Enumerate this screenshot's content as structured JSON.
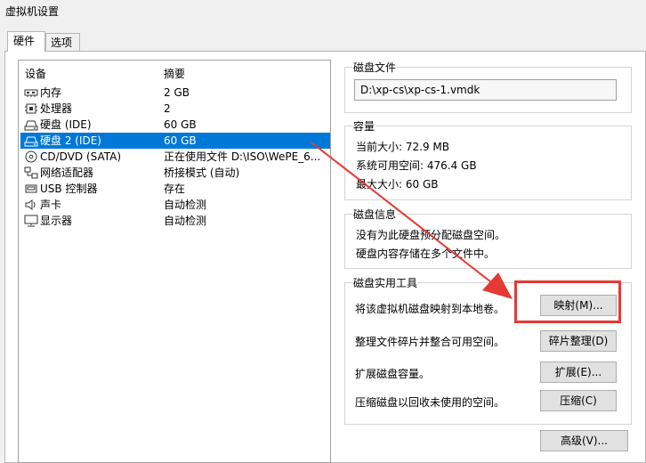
{
  "window": {
    "title": "虚拟机设置"
  },
  "tabs": [
    {
      "label": "硬件"
    },
    {
      "label": "选项"
    }
  ],
  "device_list": {
    "headers": {
      "device": "设备",
      "summary": "摘要"
    },
    "rows": [
      {
        "icon": "memory-icon",
        "name": "内存",
        "summary": "2 GB"
      },
      {
        "icon": "processor-icon",
        "name": "处理器",
        "summary": "2"
      },
      {
        "icon": "hard-disk-icon",
        "name": "硬盘 (IDE)",
        "summary": "60 GB"
      },
      {
        "icon": "hard-disk-icon",
        "name": "硬盘 2 (IDE)",
        "summary": "60 GB",
        "selected": true
      },
      {
        "icon": "cd-dvd-icon",
        "name": "CD/DVD (SATA)",
        "summary": "正在使用文件 D:\\ISO\\WePE_6..."
      },
      {
        "icon": "network-adapter-icon",
        "name": "网络适配器",
        "summary": "桥接模式 (自动)"
      },
      {
        "icon": "usb-icon",
        "name": "USB 控制器",
        "summary": "存在"
      },
      {
        "icon": "sound-card-icon",
        "name": "声卡",
        "summary": "自动检测"
      },
      {
        "icon": "display-icon",
        "name": "显示器",
        "summary": "自动检测"
      }
    ]
  },
  "disk_file": {
    "title": "磁盘文件",
    "path": "D:\\xp-cs\\xp-cs-1.vmdk"
  },
  "capacity": {
    "title": "容量",
    "current": "当前大小: 72.9 MB",
    "available": "系统可用空间: 476.4 GB",
    "max": "最大大小: 60 GB"
  },
  "disk_info": {
    "title": "磁盘信息",
    "line1": "没有为此硬盘预分配磁盘空间。",
    "line2": "硬盘内容存储在多个文件中。"
  },
  "utilities": {
    "title": "磁盘实用工具",
    "map_desc": "将该虚拟机磁盘映射到本地卷。",
    "map_button": "映射(M)...",
    "defrag_desc": "整理文件碎片并整合可用空间。",
    "defrag_button": "碎片整理(D)",
    "expand_desc": "扩展磁盘容量。",
    "expand_button": "扩展(E)...",
    "compact_desc": "压缩磁盘以回收未使用的空间。",
    "compact_button": "压缩(C)"
  },
  "advanced_button": "高级(V)...",
  "colors": {
    "selection": "#0078d7",
    "annotation": "#e53935"
  }
}
